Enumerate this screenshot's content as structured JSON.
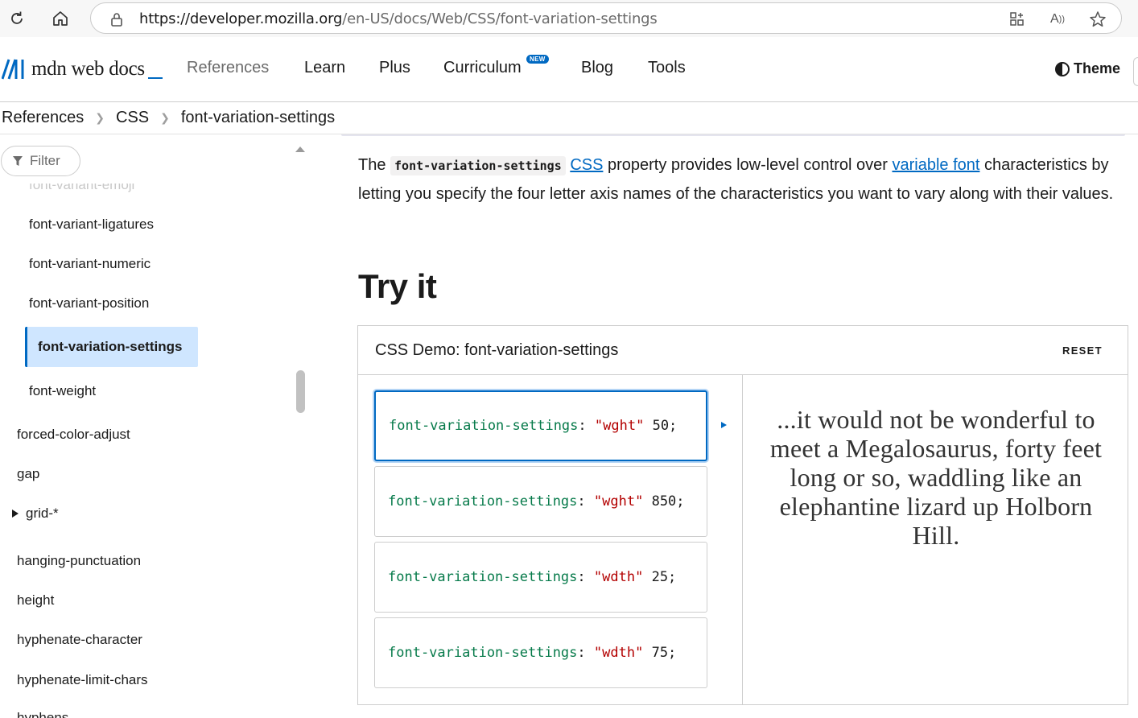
{
  "browser": {
    "url_host": "https://developer.mozilla.org",
    "url_path": "/en-US/docs/Web/CSS/font-variation-settings"
  },
  "header": {
    "logo_text": "mdn web docs",
    "nav": [
      "References",
      "Learn",
      "Plus",
      "Curriculum",
      "Blog",
      "Tools"
    ],
    "new_badge": "NEW",
    "theme_label": "Theme"
  },
  "breadcrumb": [
    "References",
    "CSS",
    "font-variation-settings"
  ],
  "sidebar": {
    "filter_label": "Filter",
    "faded_item": "font-variant-emoji",
    "items": [
      "font-variant-ligatures",
      "font-variant-numeric",
      "font-variant-position",
      "font-variation-settings",
      "font-weight",
      "forced-color-adjust",
      "gap",
      "grid-*",
      "hanging-punctuation",
      "height",
      "hyphenate-character",
      "hyphenate-limit-chars",
      "hyphens"
    ]
  },
  "intro": {
    "text_before": "The ",
    "code": "font-variation-settings",
    "css_link": "CSS",
    "text_middle": " property provides low-level control over ",
    "variable_font_link": "variable font",
    "text_after": " characteristics by letting you specify the four letter axis names of the characteristics you want to vary along with their values."
  },
  "try_it": {
    "heading": "Try it",
    "demo_title": "CSS Demo: font-variation-settings",
    "reset_label": "RESET",
    "choices": [
      {
        "prop": "font-variation-settings",
        "colon": ":",
        "str": "\"wght\"",
        "num": "50;"
      },
      {
        "prop": "font-variation-settings",
        "colon": ":",
        "str": "\"wght\"",
        "num": "850;"
      },
      {
        "prop": "font-variation-settings",
        "colon": ":",
        "str": "\"wdth\"",
        "num": "25;"
      },
      {
        "prop": "font-variation-settings",
        "colon": ":",
        "str": "\"wdth\"",
        "num": "75;"
      }
    ],
    "output_text": "...it would not be wonderful to meet a Megalosaurus, forty feet long or so, waddling like an elephantine lizard up Holborn Hill."
  },
  "colors": {
    "accent": "#0069c2",
    "active_bg": "#cfe6ff",
    "code_prop": "#067a4a",
    "code_string": "#b30000"
  }
}
